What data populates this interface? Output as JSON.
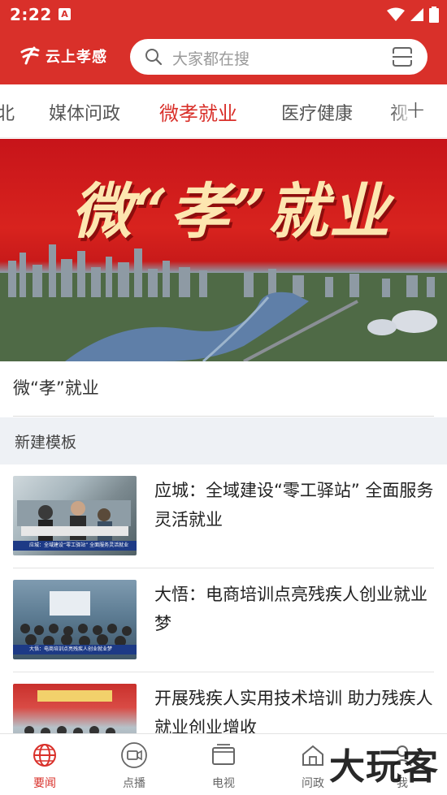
{
  "status_bar": {
    "time": "2:22",
    "notification_icon": "A"
  },
  "header": {
    "app_name": "云上孝感",
    "search_placeholder": "大家都在搜"
  },
  "tabs": {
    "items": [
      {
        "label": "北"
      },
      {
        "label": "媒体问政"
      },
      {
        "label": "微孝就业",
        "active": true
      },
      {
        "label": "医疗健康"
      },
      {
        "label": "视"
      }
    ],
    "add_label": "+"
  },
  "banner": {
    "title": "微“孝”就业"
  },
  "section": {
    "caption": "微“孝”就业",
    "group_title": "新建模板"
  },
  "news": [
    {
      "title": "应城：全域建设“零工驿站” 全面服务灵活就业",
      "thumb_caption": "应城：全域建设“零工驿站” 全面服务灵活就业"
    },
    {
      "title": "大悟：电商培训点亮残疾人创业就业梦",
      "thumb_caption": "大悟：电商培训点亮残疾人创业就业梦"
    },
    {
      "title": "开展残疾人实用技术培训 助力残疾人就业创业增收",
      "thumb_caption": ""
    }
  ],
  "bottom_nav": [
    {
      "label": "要闻",
      "icon": "globe-icon",
      "active": true
    },
    {
      "label": "点播",
      "icon": "video-icon"
    },
    {
      "label": "电视",
      "icon": "tv-icon"
    },
    {
      "label": "问政",
      "icon": "home-icon"
    },
    {
      "label": "我",
      "icon": "profile-icon"
    }
  ],
  "watermark": "大玩客",
  "colors": {
    "brand_red": "#d9302a",
    "nav_group_bg": "#eef1f5"
  }
}
